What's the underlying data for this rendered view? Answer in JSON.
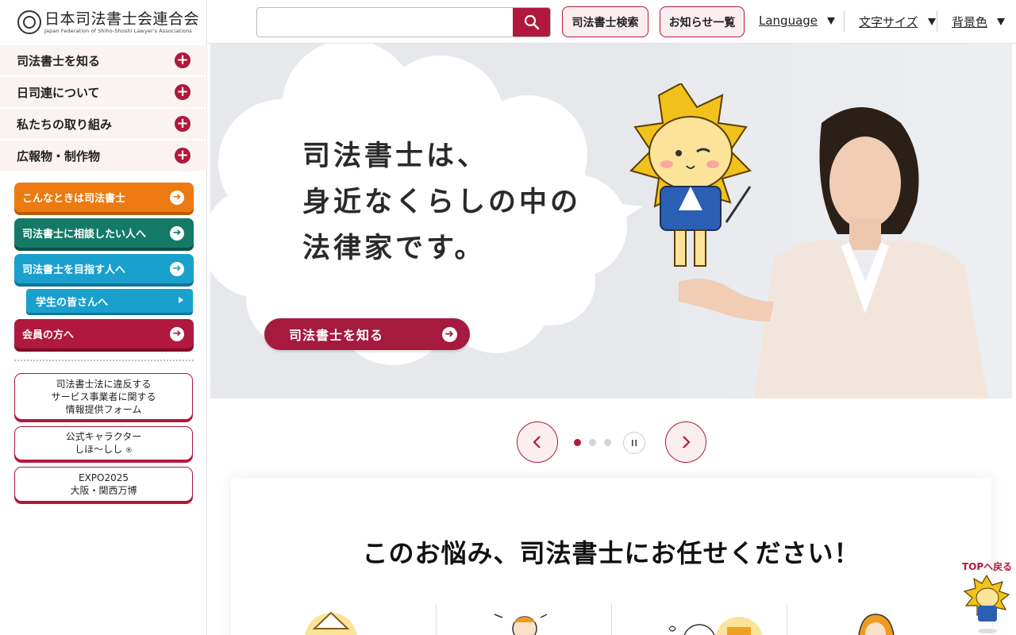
{
  "logo": {
    "title_jp": "日本司法書士会連合会",
    "subtitle_en": "Japan Federation of Shiho-Shoshi Lawyer's Associations"
  },
  "header": {
    "search_placeholder": "",
    "buttons": {
      "kensaku": "司法書士検索",
      "oshirase": "お知らせ一覧"
    },
    "dropdowns": {
      "language": "Language",
      "font_size": "文字サイズ",
      "background": "背景色"
    }
  },
  "sidebar": {
    "nav": [
      {
        "label": "司法書士を知る"
      },
      {
        "label": "日司連について"
      },
      {
        "label": "私たちの取り組み"
      },
      {
        "label": "広報物・制作物"
      }
    ],
    "cta": {
      "konna": "こんなときは司法書士",
      "soudan": "司法書士に相談したい人へ",
      "mezasu": "司法書士を目指す人へ",
      "gakusei": "学生の皆さんへ",
      "kaiin": "会員の方へ"
    },
    "cards": {
      "ihan": [
        "司法書士法に違反する",
        "サービス事業者に関する",
        "情報提供フォーム"
      ],
      "chara": [
        "公式キャラクター",
        "しほ～しし"
      ],
      "chara_mark": "®",
      "expo": [
        "EXPO2025",
        "大阪・関西万博"
      ]
    }
  },
  "hero": {
    "copy": "司法書士は、\n身近なくらしの中の\n法律家です。",
    "button": "司法書士を知る"
  },
  "carousel": {
    "active_slide": 1,
    "slides": 3
  },
  "content": {
    "title": "このお悩み、司法書士にお任せください！"
  },
  "back_to_top": {
    "label": "TOPへ戻る"
  },
  "colors": {
    "brand": "#b0183d",
    "orange": "#ec7a10",
    "green": "#147a67",
    "blue": "#1aa0cd",
    "nav_bg": "#fbf3f1"
  }
}
